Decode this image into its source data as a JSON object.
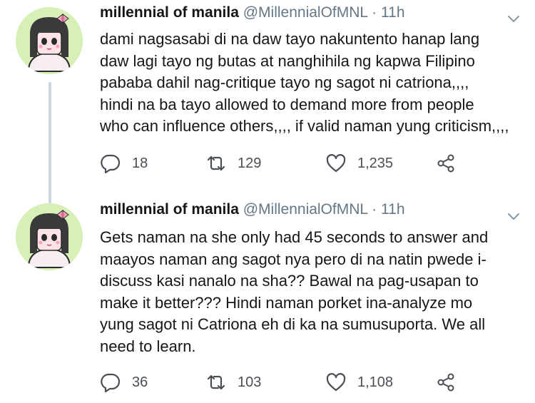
{
  "tweets": [
    {
      "name": "millennial of manila",
      "handle": "@MillennialOfMNL",
      "separator": "·",
      "time": "11h",
      "text": "dami nagsasabi di na daw tayo nakuntento hanap lang\ndaw lagi tayo ng butas at nanghihila ng kapwa Filipino\npababa dahil nag-critique tayo ng sagot ni catriona,,,,\nhindi na ba tayo allowed to demand more from people\nwho can influence others,,,, if valid naman yung criticism,,,,",
      "replies": "18",
      "retweets": "129",
      "likes": "1,235"
    },
    {
      "name": "millennial of manila",
      "handle": "@MillennialOfMNL",
      "separator": "·",
      "time": "11h",
      "text": "Gets naman na she only had 45 seconds to answer and\nmaayos naman ang sagot nya pero di na natin pwede i-\ndiscuss kasi nanalo na sha?? Bawal na pag-usapan to\nmake it better??? Hindi naman porket ina-analyze mo\nyung sagot ni Catriona eh di ka na sumusuporta. We all\nneed to learn.",
      "replies": "36",
      "retweets": "103",
      "likes": "1,108"
    }
  ],
  "icons": {
    "reply": "reply-icon",
    "retweet": "retweet-icon",
    "like": "heart-icon",
    "share": "share-icon",
    "more": "chevron-down-icon"
  },
  "colors": {
    "text": "#14171a",
    "secondary": "#657786",
    "thread_line": "#ccd6dd",
    "avatar_bg": "#d6f0b8"
  }
}
